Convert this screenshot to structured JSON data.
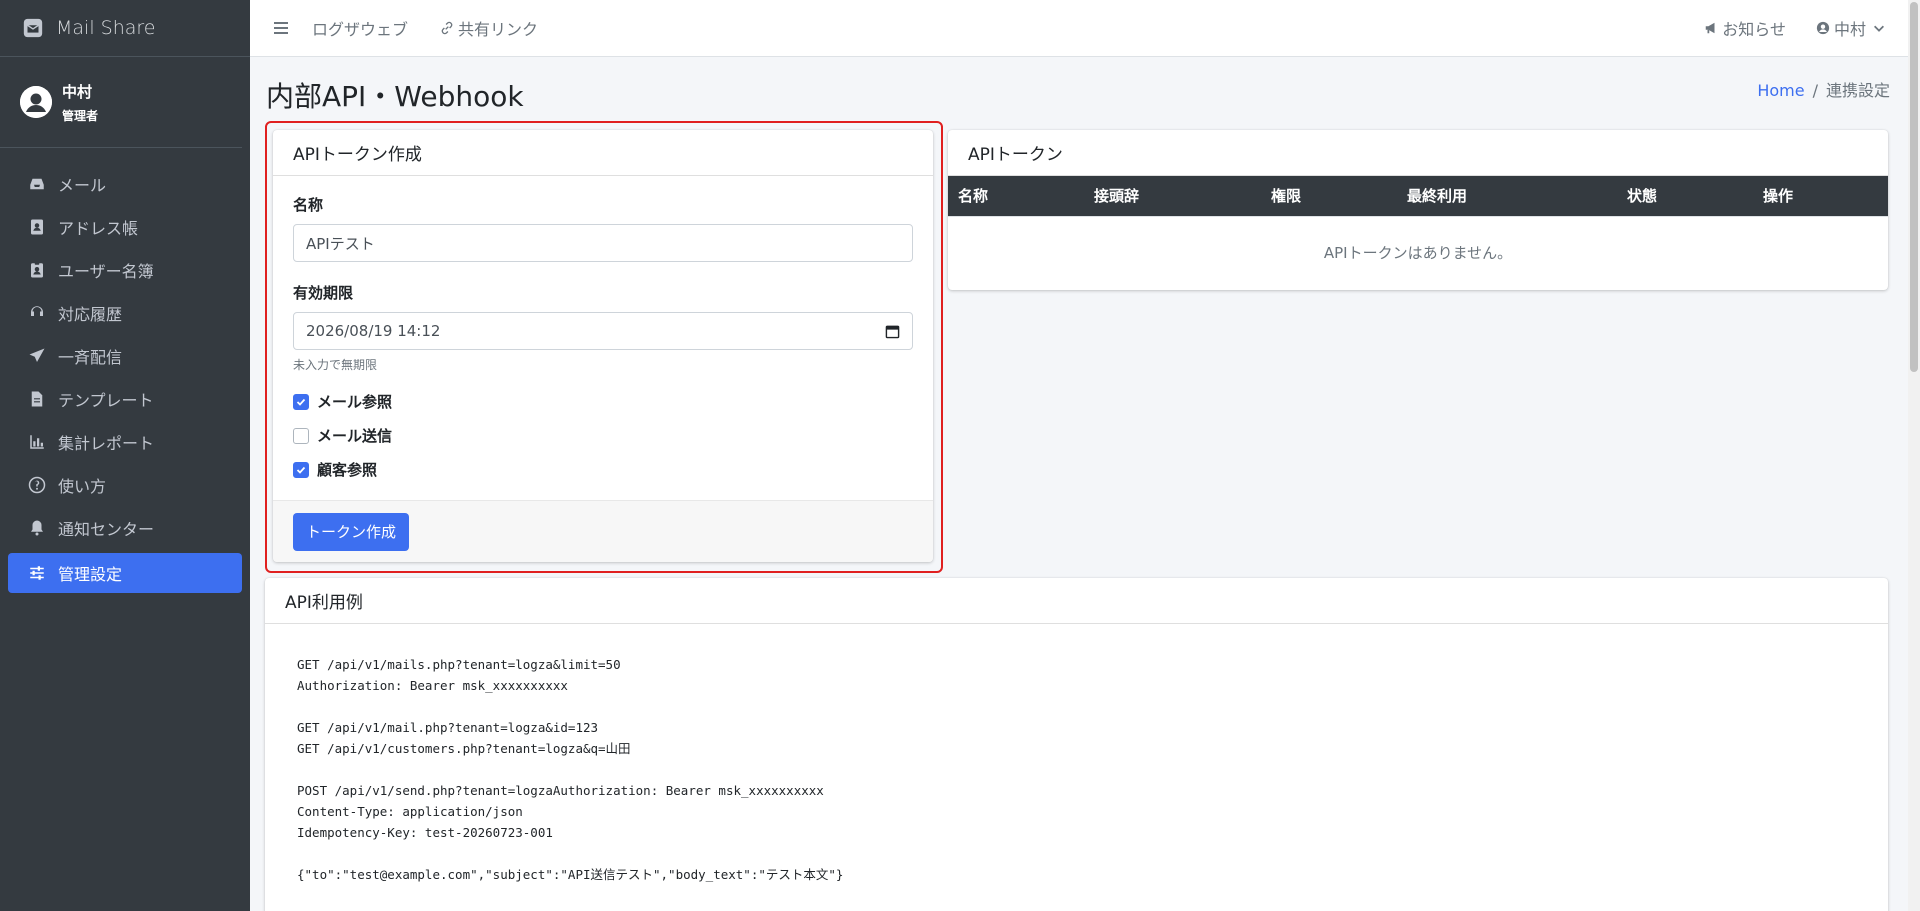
{
  "brand": {
    "name": "Mail Share"
  },
  "user": {
    "name": "中村",
    "role": "管理者"
  },
  "sidebar": {
    "items": [
      {
        "label": "メール",
        "icon": "inbox-icon"
      },
      {
        "label": "アドレス帳",
        "icon": "address-book-icon"
      },
      {
        "label": "ユーザー名簿",
        "icon": "id-badge-icon"
      },
      {
        "label": "対応履歴",
        "icon": "headset-icon"
      },
      {
        "label": "一斉配信",
        "icon": "paper-plane-icon"
      },
      {
        "label": "テンプレート",
        "icon": "file-icon"
      },
      {
        "label": "集計レポート",
        "icon": "chart-icon"
      },
      {
        "label": "使い方",
        "icon": "question-icon"
      },
      {
        "label": "通知センター",
        "icon": "bell-icon"
      },
      {
        "label": "管理設定",
        "icon": "sliders-icon",
        "active": true
      }
    ]
  },
  "topbar": {
    "links": [
      "ログザウェブ",
      "共有リンク"
    ],
    "notifications": "お知らせ",
    "user": "中村"
  },
  "page": {
    "title": "内部API・Webhook",
    "breadcrumb": {
      "home": "Home",
      "separator": "/",
      "current": "連携設定"
    }
  },
  "token_form": {
    "header": "APIトークン作成",
    "name_label": "名称",
    "name_value": "APIテスト",
    "expiry_label": "有効期限",
    "expiry_value": "2026/08/19 14:12",
    "expiry_hint": "未入力で無期限",
    "permissions": [
      {
        "label": "メール参照",
        "checked": true
      },
      {
        "label": "メール送信",
        "checked": false
      },
      {
        "label": "顧客参照",
        "checked": true
      }
    ],
    "submit_label": "トークン作成"
  },
  "token_list": {
    "header": "APIトークン",
    "columns": [
      "名称",
      "接頭辞",
      "権限",
      "最終利用",
      "状態",
      "操作"
    ],
    "empty": "APIトークンはありません。"
  },
  "usage": {
    "header": "API利用例",
    "code": "GET /api/v1/mails.php?tenant=logza&limit=50\nAuthorization: Bearer msk_xxxxxxxxxx\n\nGET /api/v1/mail.php?tenant=logza&id=123\nGET /api/v1/customers.php?tenant=logza&q=山田\n\nPOST /api/v1/send.php?tenant=logzaAuthorization: Bearer msk_xxxxxxxxxx\nContent-Type: application/json\nIdempotency-Key: test-20260723-001\n\n{\"to\":\"test@example.com\",\"subject\":\"API送信テスト\",\"body_text\":\"テスト本文\"}"
  },
  "colors": {
    "sidebar": "#343a40",
    "accent": "#3d6ff0",
    "highlight": "#e02020"
  }
}
